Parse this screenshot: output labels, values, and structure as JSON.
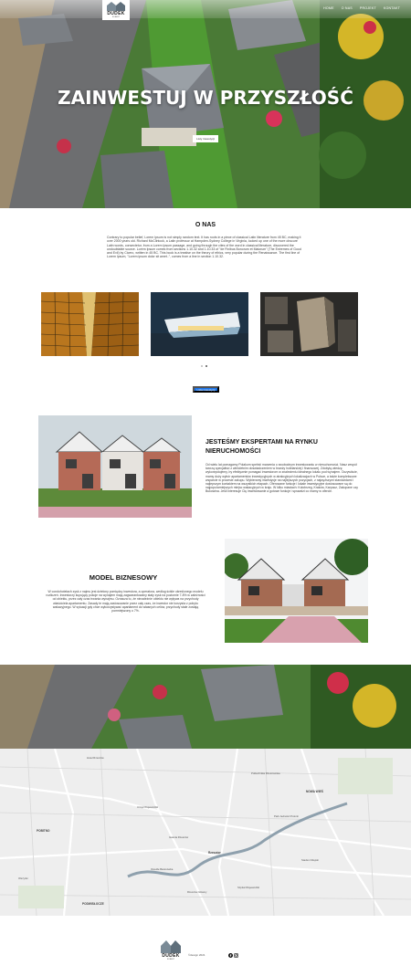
{
  "header": {
    "logo": "DUDEK",
    "logo_sub": "ROBERT",
    "nav": [
      "HOME",
      "O NAS",
      "PROJEKT",
      "KONTAKT"
    ]
  },
  "hero": {
    "title": "ZAINWESTUJ W PRZYSZŁOŚĆ",
    "button": "Listy inwestycji"
  },
  "about": {
    "title": "O NAS",
    "text": "Contrary to popular belief, Lorem Ipsum is not simply random text. It has roots in a piece of classical Latin literature from 45 BC, making it over 2000 years old. Richard McClintock, a Latin professor at Hampden-Sydney College in Virginia, looked up one of the more obscure Latin words, consectetur, from a Lorem Ipsum passage, and going through the cites of the word in classical literature, discovered the undoubtable source. Lorem Ipsum comes from sections 1.10.32 and 1.10.33 of \"de Finibus Bonorum et Malorum\" (The Extremes of Good and Evil) by Cicero, written in 45 BC. This book is a treatise on the theory of ethics, very popular during the Renaissance. The first line of Lorem Ipsum, \"Lorem ipsum dolor sit amet..\", comes from a line in section 1.10.32.",
    "more_button": "Lista inwestycji"
  },
  "experts": {
    "title": "JESTEŚMY EKSPERTAMI NA RYNKU NIERUCHOMOŚCI",
    "text": "Od wielu lat pomagamy Polakom spełnić marzenia o swobodnym inwestowaniu w nieruchomości. Nasz zespół tworzą specjaliści z wieloletnim doświadczeniem w branży hotelarskiej i finansowej. Zdobytą wiedzę wykorzystujemy, by efektywnie pomagać inwestorom w znalezieniu idealnego lokalu pod wynajem. Oczywiście, mamy duży wybór apartamentów inwestycyjnych w atrakcyjnych lokalizacjach w Polsce, a także kompleksowe wsparcie w procesie zakupu. Wybieramy inwestycje na najlepszych pozycjach, z najwyższymi standardami i najlepszym kontaktem na wszystkich etapach. Oferowane funkcje i lokale inwestycyjne dostosowane są do najpopularniejszych miejsc wakacyjnych w kraju. W kilku miastach: Kołobrzeg, Kraków, Karpacz, Zakopane czy Bukowina. Jeśli interesuje Cię inwestowanie a gotowe funkcje i sprawdzi co mamy w ofercie."
  },
  "business": {
    "title": "MODEL BIZNESOWY",
    "text": "W condohotelach zysk z najmu jest dzielony pomiędzy inwestora, a operatora, według ściśle określonego modelu rozliczeń. Inwestorzy kupujący pokoje na wynajem mają zagwarantowany stały zysk na poziomie 7-8% w zależności od obiektu, przez cały czas trwania wynajmu. Oznacza to, że niezależnie obiektu nie wpływa na przychody właściciela apartamentu. Zasady te mają zastosowanie przez cały czas, że inwestor nie korzysta z pobytu wakacyjnego. W sytuacji gdy chce wykorzystywać apartament do własnych celów, przychody stale zostają pomniejszony o 7%."
  },
  "map": {
    "labels": [
      "Hotel Rzeszów",
      "NOWA WIEŚ",
      "POBITNO",
      "PODWISŁOCZE",
      "Rzeszów",
      "Galeria Rzeszów",
      "Politechnika Rzeszowska",
      "Urząd Wojewódzki",
      "Szpital Wojewódzki",
      "Park Jedności Polonii",
      "Olszynki",
      "Osiedle Baranówka",
      "Rzeszów Główny",
      "Stadion Miejski"
    ]
  },
  "footer": {
    "logo": "DUDEK",
    "logo_sub": "ROBERT",
    "copy": "©design 2021"
  },
  "colors": {
    "accent": "#1a73e8",
    "grass": "#3f8a2e",
    "roof": "#6b6f74"
  }
}
